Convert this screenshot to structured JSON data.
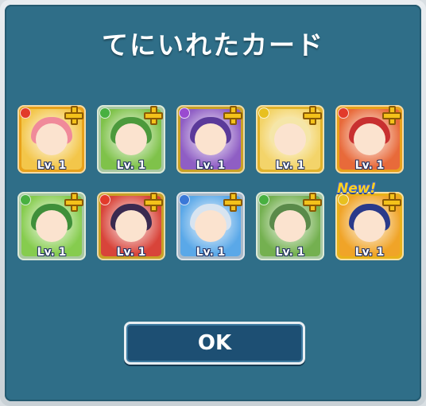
{
  "dialog": {
    "title": "てにいれたカード",
    "ok_label": "OK"
  },
  "cards": [
    {
      "level": "Lv. 1",
      "frame": "#e9a21a",
      "bg": "#f3c64a",
      "orb": "#e23a2a",
      "hair": "#f08a9a",
      "new": false
    },
    {
      "level": "Lv. 1",
      "frame": "#a8c8a0",
      "bg": "#7fc24a",
      "orb": "#48b040",
      "hair": "#4c9a3c",
      "new": false
    },
    {
      "level": "Lv. 1",
      "frame": "#c9a126",
      "bg": "#8f5ec4",
      "orb": "#9a4ad0",
      "hair": "#5b3a9a",
      "new": false
    },
    {
      "level": "Lv. 1",
      "frame": "#e2b32a",
      "bg": "#f3d46a",
      "orb": "#e8c020",
      "hair": "#f5e6a8",
      "new": false
    },
    {
      "level": "Lv. 1",
      "frame": "#e9a21a",
      "bg": "#e86a3a",
      "orb": "#e23a2a",
      "hair": "#c83030",
      "new": false
    },
    {
      "level": "Lv. 1",
      "frame": "#a8c8a0",
      "bg": "#86cc4e",
      "orb": "#48b040",
      "hair": "#3f8f3a",
      "new": false
    },
    {
      "level": "Lv. 1",
      "frame": "#c9a126",
      "bg": "#d8443a",
      "orb": "#e23a2a",
      "hair": "#3a2a50",
      "new": false
    },
    {
      "level": "Lv. 1",
      "frame": "#a9b9c8",
      "bg": "#5aa8e8",
      "orb": "#3a78d8",
      "hair": "#d8e4f0",
      "new": false
    },
    {
      "level": "Lv. 1",
      "frame": "#a8c8a0",
      "bg": "#74b050",
      "orb": "#48b040",
      "hair": "#5a8a4a",
      "new": false
    },
    {
      "level": "Lv. 1",
      "frame": "#e9b21a",
      "bg": "#f0a428",
      "orb": "#e8c020",
      "hair": "#2a3a8a",
      "new": true,
      "new_label": "New!"
    }
  ],
  "colors": {
    "panel": "#2f6e88",
    "button": "#1d4f73",
    "plus": "#f4c21a"
  }
}
